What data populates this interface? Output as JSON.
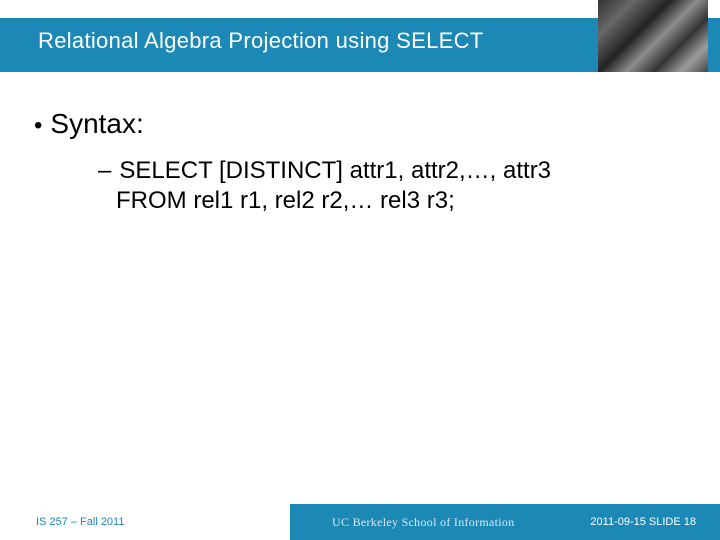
{
  "header": {
    "title": "Relational Algebra Projection using SELECT"
  },
  "content": {
    "bullet_label": "Syntax:",
    "sub_line1": "SELECT  [DISTINCT] attr1, attr2,…, attr3",
    "sub_line2": "FROM rel1 r1, rel2 r2,… rel3 r3;"
  },
  "footer": {
    "left": "IS 257 – Fall 2011",
    "school": "UC Berkeley School of Information",
    "right": "2011-09-15 SLIDE 18"
  }
}
